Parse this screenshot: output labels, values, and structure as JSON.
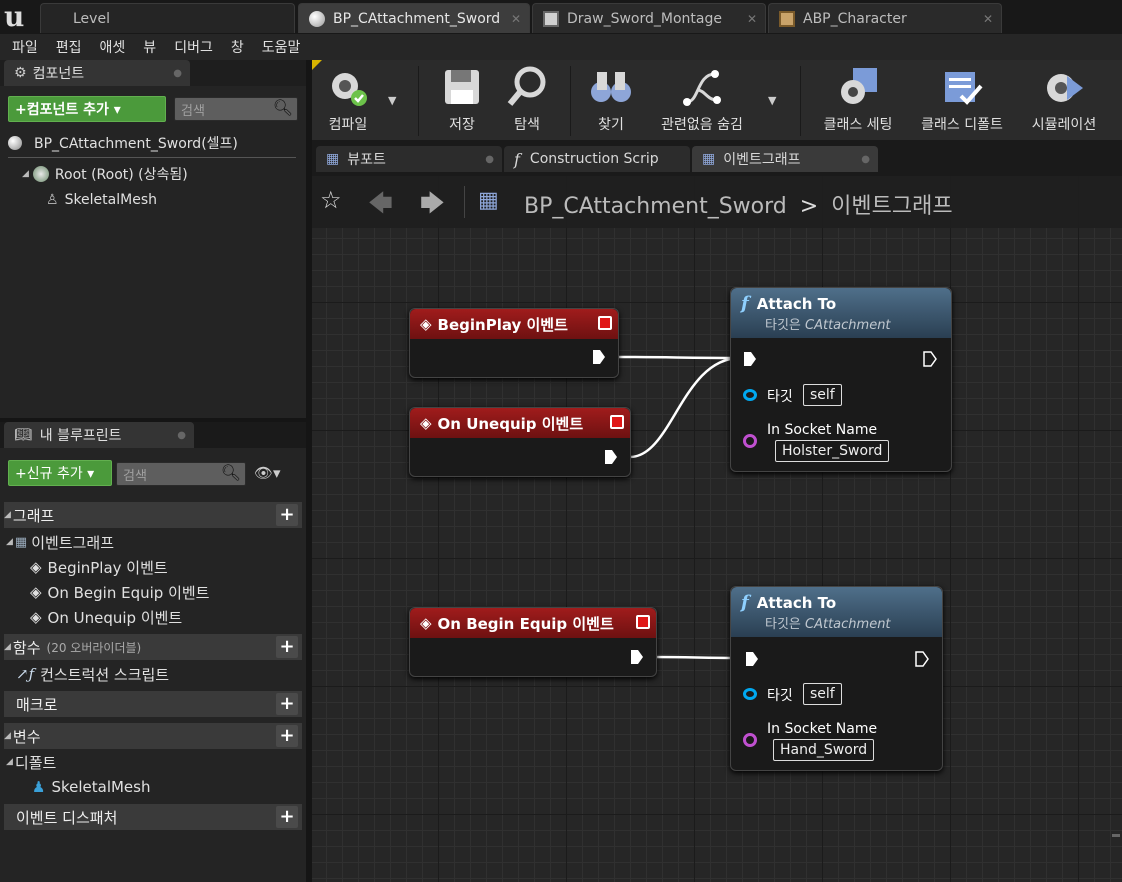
{
  "tabs": [
    {
      "label": "Level"
    },
    {
      "label": "BP_CAttachment_Sword"
    },
    {
      "label": "Draw_Sword_Montage"
    },
    {
      "label": "ABP_Character"
    }
  ],
  "menu": [
    "파일",
    "편집",
    "애셋",
    "뷰",
    "디버그",
    "창",
    "도움말"
  ],
  "components": {
    "title": "컴포넌트",
    "add_button": "+컴포넌트 추가 ▾",
    "search_placeholder": "검색",
    "self_item": "BP_CAttachment_Sword(셀프)",
    "root_item": "Root (Root) (상속됨)",
    "skeletal_item": "SkeletalMesh"
  },
  "myblueprint": {
    "title": "내 블루프린트",
    "add_button": "+신규 추가 ▾",
    "search_placeholder": "검색",
    "graphs_label": "그래프",
    "eventgraph_label": "이벤트그래프",
    "events": [
      "BeginPlay 이벤트",
      "On Begin Equip 이벤트",
      "On Unequip 이벤트"
    ],
    "functions_label": "함수",
    "functions_count": "(20 오버라이더블)",
    "construction_label": "컨스트럭션 스크립트",
    "macros_label": "매크로",
    "variables_label": "변수",
    "default_label": "디폴트",
    "variable_item": "SkeletalMesh",
    "dispatchers_label": "이벤트 디스패처"
  },
  "toolbar": [
    {
      "label": "컴파일"
    },
    {
      "label": "저장"
    },
    {
      "label": "탐색"
    },
    {
      "label": "찾기"
    },
    {
      "label": "관련없음 숨김"
    },
    {
      "label": "클래스 세팅"
    },
    {
      "label": "클래스 디폴트"
    },
    {
      "label": "시뮬레이션"
    }
  ],
  "docktabs": [
    {
      "label": "뷰포트"
    },
    {
      "label": "Construction Scrip"
    },
    {
      "label": "이벤트그래프"
    }
  ],
  "breadcrumb": {
    "blueprint": "BP_CAttachment_Sword",
    "separator": ">",
    "graph": "이벤트그래프"
  },
  "nodes": {
    "beginplay": {
      "title": "BeginPlay 이벤트"
    },
    "unequip": {
      "title": "On Unequip 이벤트"
    },
    "beginequip": {
      "title": "On Begin Equip 이벤트"
    },
    "attach1": {
      "title": "Attach To",
      "subtitle_prefix": "타깃은 ",
      "subtitle_class": "CAttachment",
      "target_label": "타깃",
      "target_value": "self",
      "socket_label": "In Socket Name",
      "socket_value": "Holster_Sword"
    },
    "attach2": {
      "title": "Attach To",
      "subtitle_prefix": "타깃은 ",
      "subtitle_class": "CAttachment",
      "target_label": "타깃",
      "target_value": "self",
      "socket_label": "In Socket Name",
      "socket_value": "Hand_Sword"
    }
  },
  "colors": {
    "event_header": "#a01c1c",
    "function_header": "#4f6f8a",
    "accent_green": "#4b9a3b",
    "object_pin": "#00a8f0",
    "name_pin": "#c050d0"
  }
}
